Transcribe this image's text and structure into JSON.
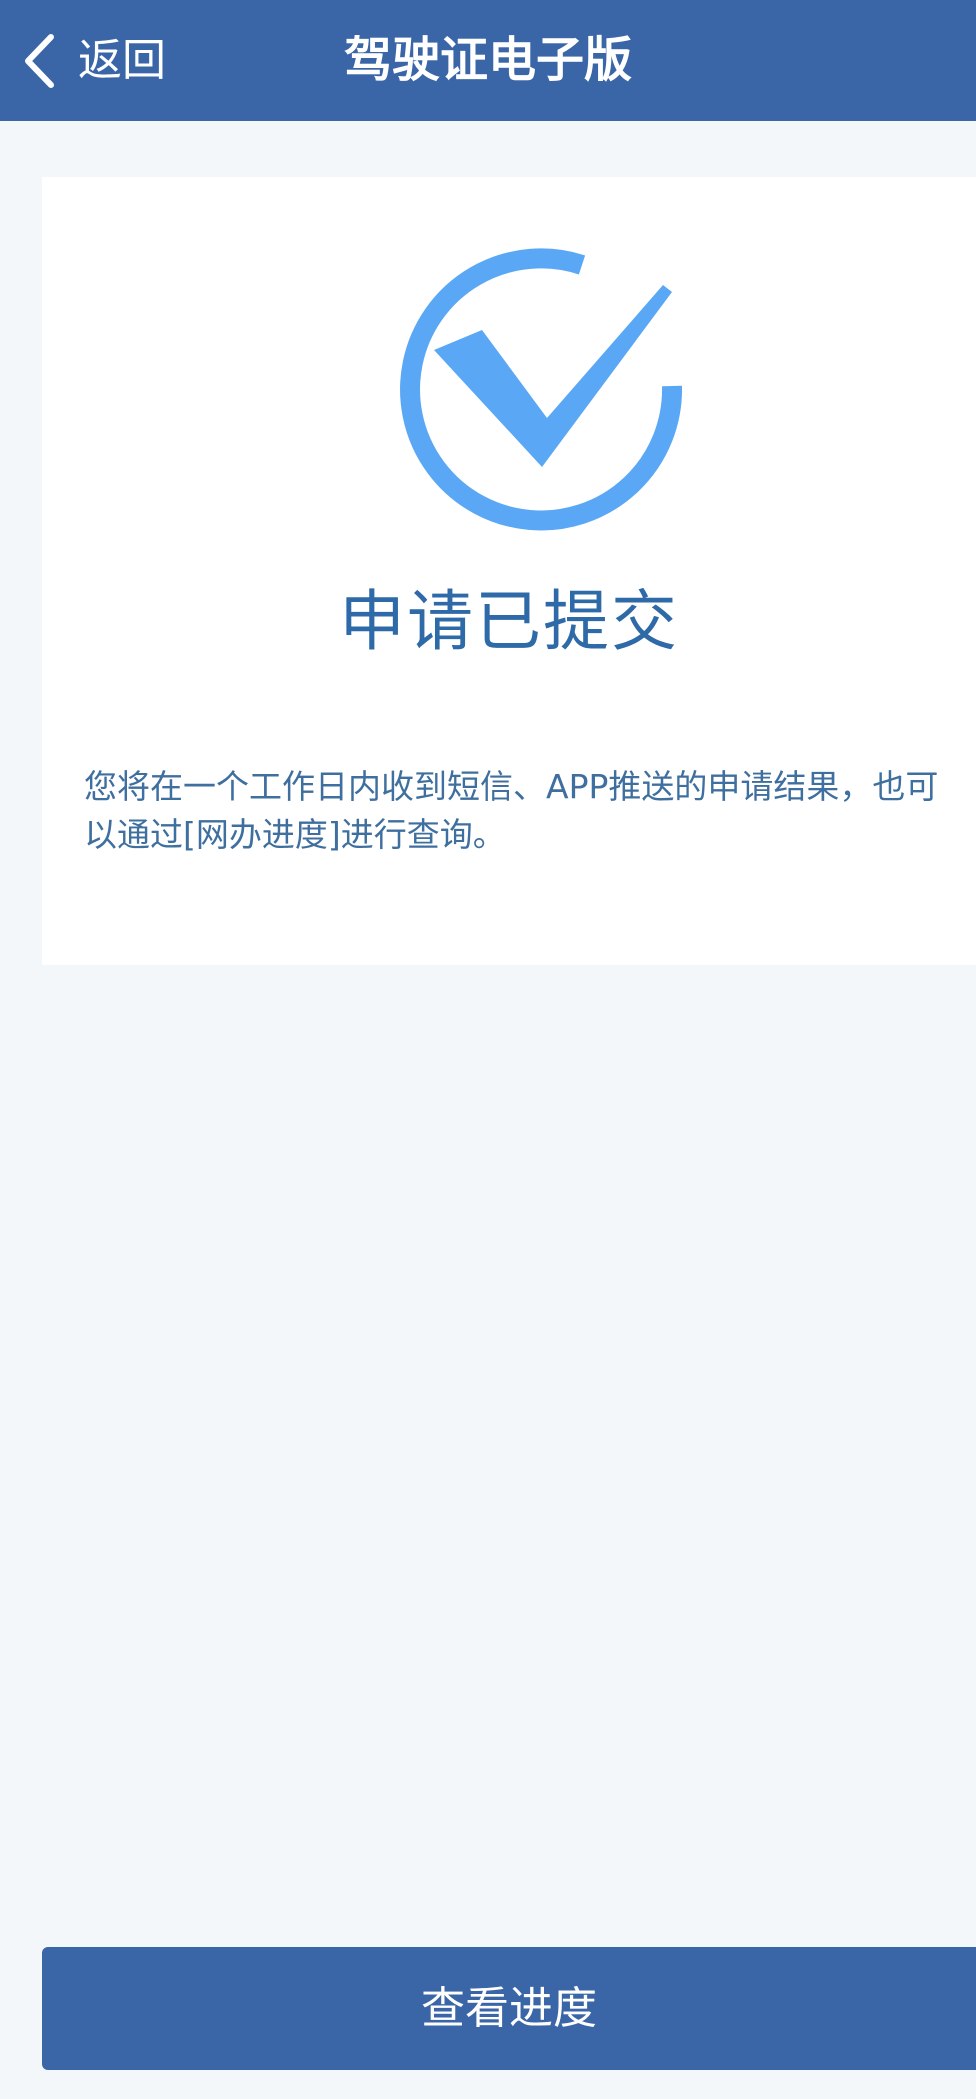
{
  "nav": {
    "back_label": "返回",
    "title": "驾驶证电子版"
  },
  "card": {
    "icon": "check-circle-icon",
    "status_title": "申请已提交",
    "message": "您将在一个工作日内收到短信、APP推送的申请结果，也可以通过[网办进度]进行查询。"
  },
  "footer": {
    "progress_button_label": "查看进度"
  },
  "colors": {
    "nav_background": "#3a66a8",
    "page_background": "#f3f7f9",
    "icon_blue": "#5aa8f5",
    "title_blue": "#2f6aa8",
    "message_blue": "#3f6f9f"
  }
}
